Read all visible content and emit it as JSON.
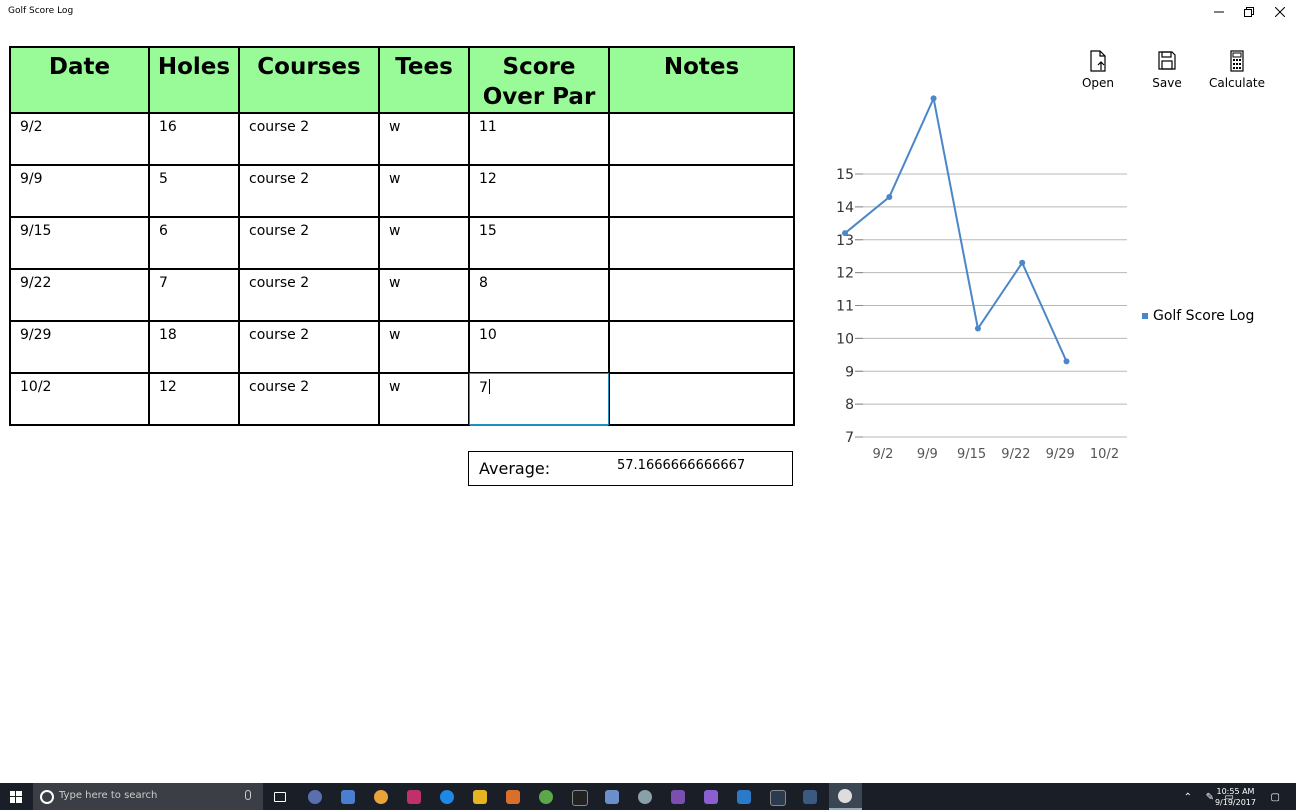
{
  "window": {
    "title": "Golf Score Log",
    "controls": [
      "minimize-icon",
      "restore-icon",
      "close-icon"
    ]
  },
  "table": {
    "headers": [
      "Date",
      "Holes",
      "Courses",
      "Tees",
      "Score Over Par",
      "Notes"
    ],
    "rows": [
      [
        "9/2",
        "16",
        "course 2",
        "w",
        "11",
        ""
      ],
      [
        "9/9",
        "5",
        "course 2",
        "w",
        "12",
        ""
      ],
      [
        "9/15",
        "6",
        "course 2",
        "w",
        "15",
        ""
      ],
      [
        "9/22",
        "7",
        "course 2",
        "w",
        "8",
        ""
      ],
      [
        "9/29",
        "18",
        "course 2",
        "w",
        "10",
        ""
      ],
      [
        "10/2",
        "12",
        "course 2",
        "w",
        "7",
        ""
      ]
    ],
    "header_color": "#98fb98"
  },
  "average": {
    "label": "Average:",
    "value": "57.1666666666667"
  },
  "commands": [
    {
      "label": "Open",
      "icon": "open-file-icon"
    },
    {
      "label": "Save",
      "icon": "save-icon"
    },
    {
      "label": "Calculate",
      "icon": "calculator-icon"
    }
  ],
  "chart_data": {
    "type": "line",
    "categories": [
      "9/2",
      "9/9",
      "9/15",
      "9/22",
      "9/29",
      "10/2"
    ],
    "series": [
      {
        "name": "Golf Score Log",
        "points": [
          {
            "x": 0.0,
            "y": 13.2
          },
          {
            "x": 1.0,
            "y": 14.3
          },
          {
            "x": 2.0,
            "y": 17.3
          },
          {
            "x": 3.0,
            "y": 10.3
          },
          {
            "x": 4.0,
            "y": 12.3
          },
          {
            "x": 5.0,
            "y": 9.3
          }
        ]
      }
    ],
    "y_ticks": [
      7,
      8,
      9,
      10,
      11,
      12,
      13,
      14,
      15
    ],
    "ylim": [
      7,
      15
    ],
    "grid": true,
    "legend": "right",
    "color": "#4a86c8"
  },
  "taskbar": {
    "search_placeholder": "Type here to search",
    "time": "10:55 AM",
    "date": "9/19/2017"
  }
}
